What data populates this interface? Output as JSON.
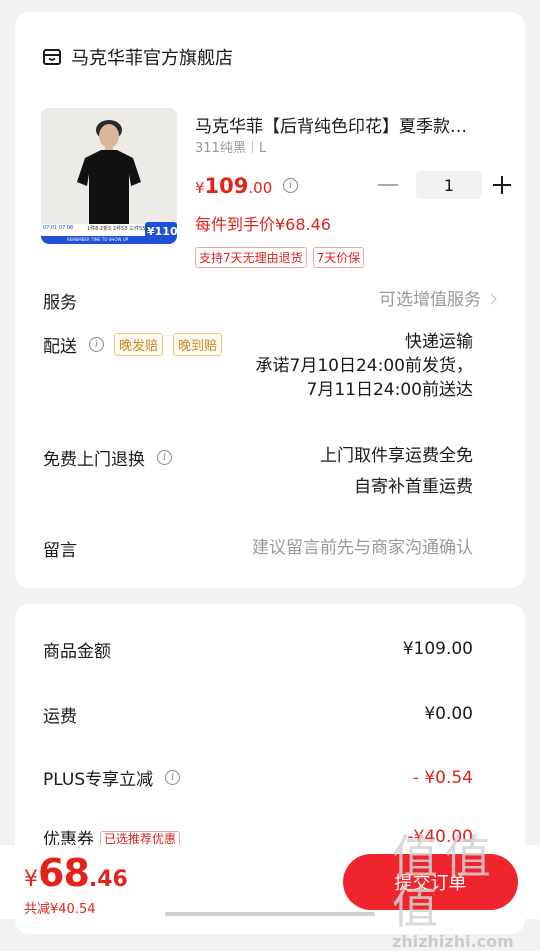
{
  "shop": {
    "icon": "store-icon",
    "name": "马克华菲官方旗舰店"
  },
  "product": {
    "title": "马克华菲【后背纯色印花】夏季款…",
    "spec": "311纯黑｜L",
    "price_symbol": "¥",
    "price_int": "109",
    "price_dec": ".00",
    "each_price": "每件到手价¥68.46",
    "tags": [
      "支持7天无理由退货",
      "7天价保"
    ],
    "quantity": "1",
    "thumb": {
      "dates": "07.01  07.08",
      "promo_line": "1件8.2折5  2件53  三件55折",
      "banner": "REMEMBER  TIME TO SHOW UP",
      "price_tag": "¥110"
    }
  },
  "rows": {
    "service_label": "服务",
    "service_value": "可选增值服务",
    "delivery_label": "配送",
    "delivery_tags": [
      "晚发赔",
      "晚到赔"
    ],
    "delivery_method": "快递运输",
    "delivery_ship": "承诺7月10日24:00前发货，",
    "delivery_arrive": "7月11日24:00前送达",
    "return_label": "免费上门退换",
    "return_line1": "上门取件享运费全免",
    "return_line2": "自寄补首重运费",
    "note_label": "留言",
    "note_placeholder": "建议留言前先与商家沟通确认"
  },
  "summary": {
    "goods_label": "商品金额",
    "goods_value": "¥109.00",
    "shipping_label": "运费",
    "shipping_value": "¥0.00",
    "plus_label": "PLUS专享立减",
    "plus_value": "- ¥0.54",
    "coupon_label": "优惠券",
    "coupon_tag": "已选推荐优惠",
    "coupon_value": "-¥40.00"
  },
  "bottom": {
    "total_symbol": "¥",
    "total_int": "68",
    "total_dec": ".46",
    "saved": "共减¥40.54",
    "submit": "提交订单"
  },
  "watermark": {
    "big": "值 值 值",
    "small": "zhizhizhi.com"
  },
  "colors": {
    "accent": "#e2231a",
    "button": "#f0242c",
    "background": "#f2f2f2"
  }
}
